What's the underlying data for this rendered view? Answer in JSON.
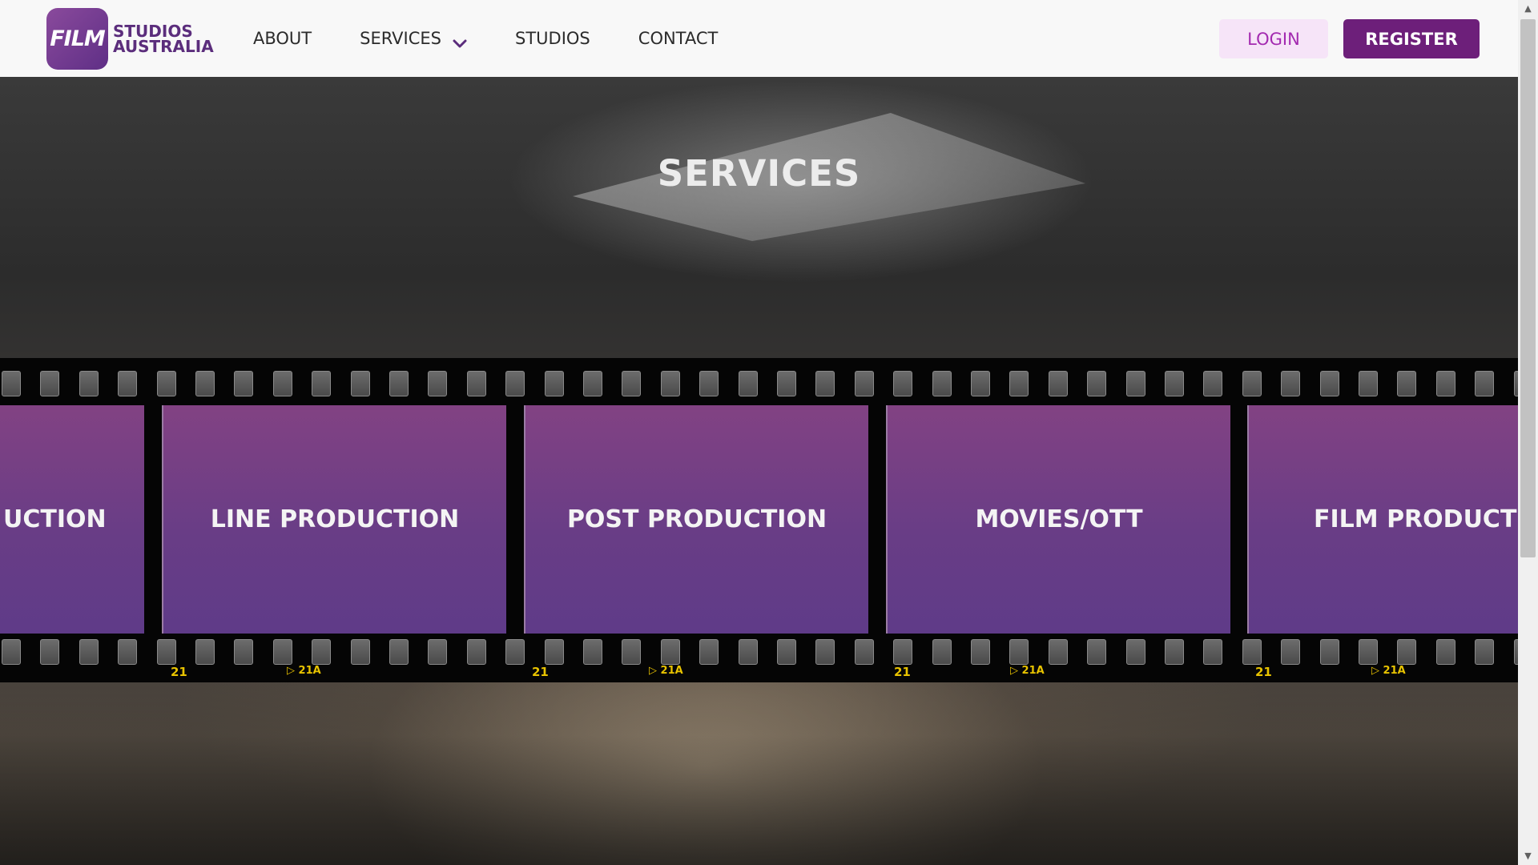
{
  "header": {
    "logo": {
      "badge": "FILM",
      "line1": "STUDIOS",
      "line2": "AUSTRALIA"
    },
    "nav": [
      {
        "label": "ABOUT"
      },
      {
        "label": "SERVICES",
        "has_dropdown": true
      },
      {
        "label": "STUDIOS"
      },
      {
        "label": "CONTACT"
      }
    ],
    "login_label": "LOGIN",
    "register_label": "REGISTER"
  },
  "hero": {
    "title": "SERVICES"
  },
  "services": [
    {
      "label": "UCTION"
    },
    {
      "label": "LINE PRODUCTION"
    },
    {
      "label": "POST PRODUCTION"
    },
    {
      "label": "MOVIES/OTT"
    },
    {
      "label": "FILM PRODUCTION"
    }
  ],
  "filmstrip": {
    "frame_number": "21",
    "frame_code": "21A"
  },
  "colors": {
    "brand_purple": "#6d1f7a",
    "login_bg": "#f6e4f8",
    "login_text": "#a32ab0",
    "frame_top": "#824283",
    "frame_bottom": "#5f3b88",
    "edge_code": "#e8c300"
  },
  "icons": {
    "dropdown": "chevron-down-icon",
    "scroll_up": "scroll-up-arrow-icon",
    "scroll_down": "scroll-down-arrow-icon"
  }
}
